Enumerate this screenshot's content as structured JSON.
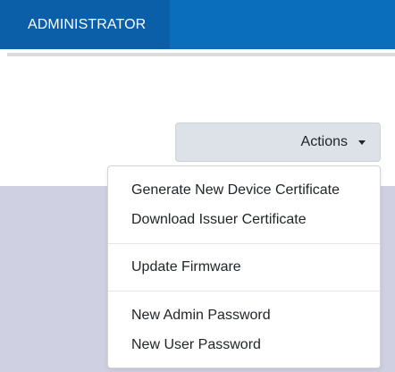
{
  "header": {
    "tab_label": "ADMINISTRATOR"
  },
  "actions": {
    "button_label": "Actions",
    "icon": "caret-down-icon"
  },
  "menu": {
    "groups": [
      {
        "items": [
          {
            "label": "Generate New Device Certificate"
          },
          {
            "label": "Download Issuer Certificate"
          }
        ]
      },
      {
        "items": [
          {
            "label": "Update Firmware"
          }
        ]
      },
      {
        "items": [
          {
            "label": "New Admin Password"
          },
          {
            "label": "New User Password"
          }
        ]
      }
    ]
  },
  "colors": {
    "header_bar": "#0a6ebd",
    "active_tab": "#0a5fa8",
    "panel": "#cfd0e2",
    "button": "#dde1e8"
  }
}
